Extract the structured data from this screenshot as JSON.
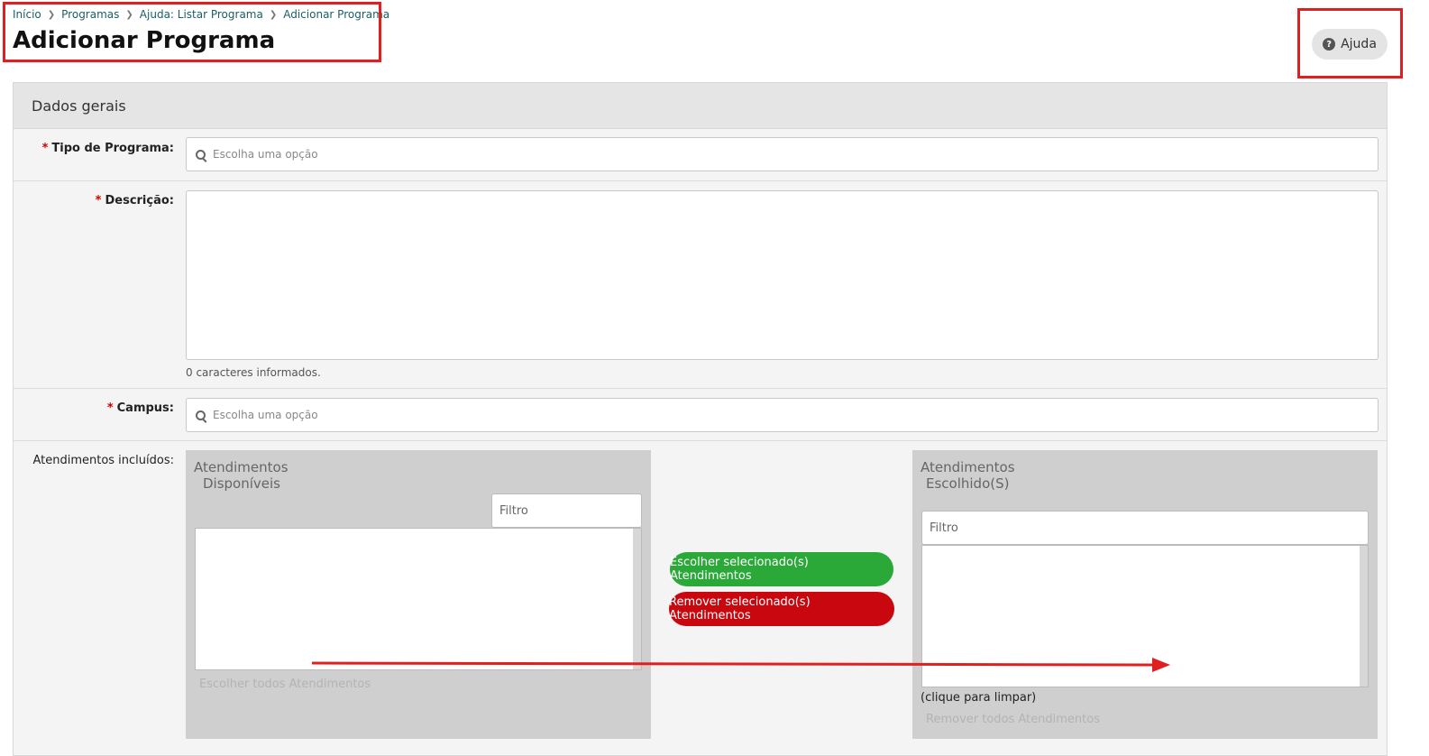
{
  "breadcrumb": {
    "items": [
      "Início",
      "Programas",
      "Ajuda: Listar Programa",
      "Adicionar Programa"
    ]
  },
  "page_title": "Adicionar Programa",
  "help_button": {
    "label": "Ajuda",
    "icon": "question-circle-icon"
  },
  "panel": {
    "title": "Dados gerais"
  },
  "form": {
    "tipo_programa": {
      "label": "Tipo de Programa:",
      "required_mark": "*",
      "placeholder": "Escolha uma opção"
    },
    "descricao": {
      "label": "Descrição:",
      "required_mark": "*",
      "char_count": "0 caracteres informados."
    },
    "campus": {
      "label": "Campus:",
      "required_mark": "*",
      "placeholder": "Escolha uma opção"
    },
    "atendimentos": {
      "label": "Atendimentos incluídos:",
      "available": {
        "title_line1": "Atendimentos",
        "title_line2": "Disponíveis",
        "filter_placeholder": "Filtro",
        "choose_all": "Escolher todos Atendimentos"
      },
      "chosen": {
        "title_line1": "Atendimentos",
        "title_line2": "Escolhido(S)",
        "filter_placeholder": "Filtro",
        "clear_hint": "(clique para limpar)",
        "remove_all": "Remover todos Atendimentos"
      },
      "choose_selected": "Escolher selecionado(s) Atendimentos",
      "remove_selected": "Remover selecionado(s) Atendimentos"
    }
  },
  "colors": {
    "annotation": "#e02020",
    "choose_button": "#2aa838",
    "remove_button": "#c8080e",
    "breadcrumb_link": "#1a5f63"
  }
}
